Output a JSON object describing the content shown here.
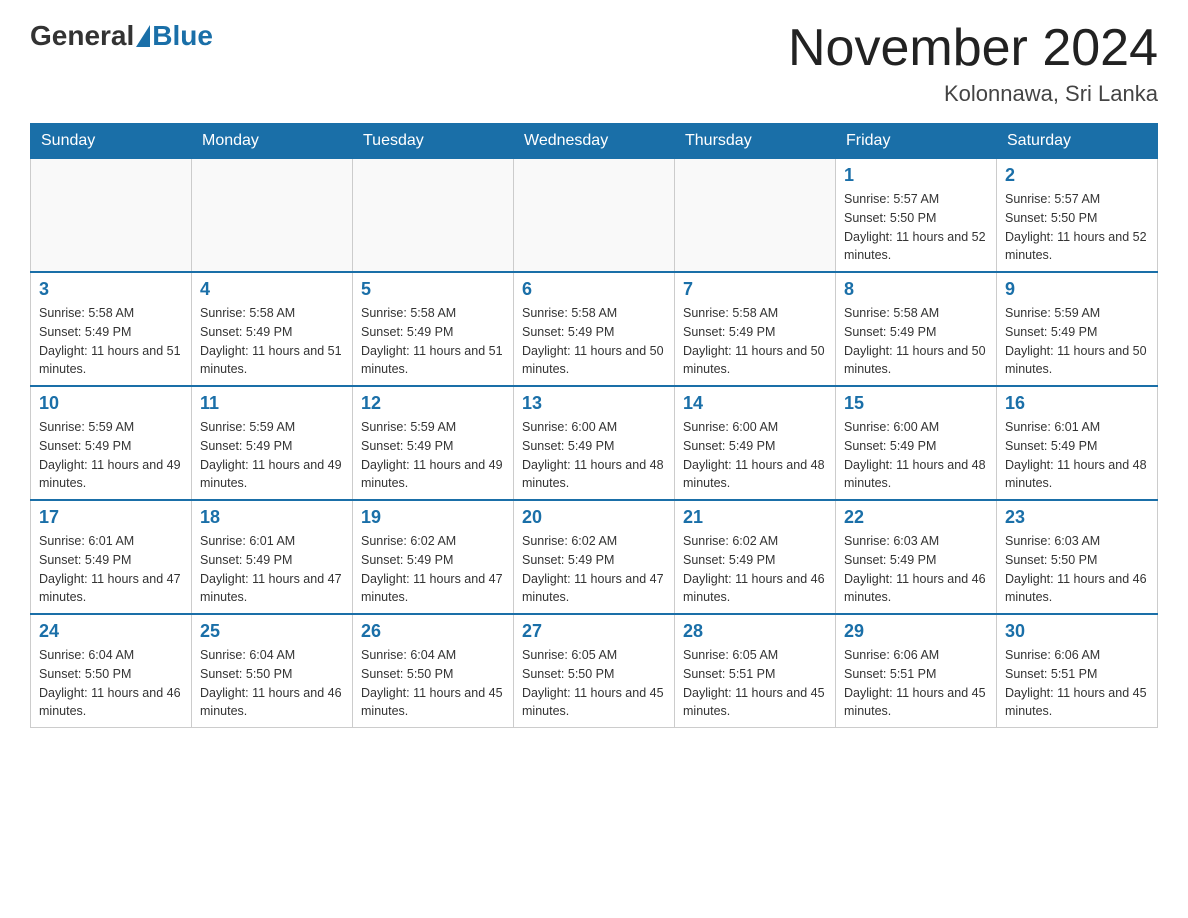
{
  "header": {
    "logo_general": "General",
    "logo_blue": "Blue",
    "month_year": "November 2024",
    "location": "Kolonnawa, Sri Lanka"
  },
  "weekdays": [
    "Sunday",
    "Monday",
    "Tuesday",
    "Wednesday",
    "Thursday",
    "Friday",
    "Saturday"
  ],
  "weeks": [
    [
      {
        "day": "",
        "sunrise": "",
        "sunset": "",
        "daylight": ""
      },
      {
        "day": "",
        "sunrise": "",
        "sunset": "",
        "daylight": ""
      },
      {
        "day": "",
        "sunrise": "",
        "sunset": "",
        "daylight": ""
      },
      {
        "day": "",
        "sunrise": "",
        "sunset": "",
        "daylight": ""
      },
      {
        "day": "",
        "sunrise": "",
        "sunset": "",
        "daylight": ""
      },
      {
        "day": "1",
        "sunrise": "Sunrise: 5:57 AM",
        "sunset": "Sunset: 5:50 PM",
        "daylight": "Daylight: 11 hours and 52 minutes."
      },
      {
        "day": "2",
        "sunrise": "Sunrise: 5:57 AM",
        "sunset": "Sunset: 5:50 PM",
        "daylight": "Daylight: 11 hours and 52 minutes."
      }
    ],
    [
      {
        "day": "3",
        "sunrise": "Sunrise: 5:58 AM",
        "sunset": "Sunset: 5:49 PM",
        "daylight": "Daylight: 11 hours and 51 minutes."
      },
      {
        "day": "4",
        "sunrise": "Sunrise: 5:58 AM",
        "sunset": "Sunset: 5:49 PM",
        "daylight": "Daylight: 11 hours and 51 minutes."
      },
      {
        "day": "5",
        "sunrise": "Sunrise: 5:58 AM",
        "sunset": "Sunset: 5:49 PM",
        "daylight": "Daylight: 11 hours and 51 minutes."
      },
      {
        "day": "6",
        "sunrise": "Sunrise: 5:58 AM",
        "sunset": "Sunset: 5:49 PM",
        "daylight": "Daylight: 11 hours and 50 minutes."
      },
      {
        "day": "7",
        "sunrise": "Sunrise: 5:58 AM",
        "sunset": "Sunset: 5:49 PM",
        "daylight": "Daylight: 11 hours and 50 minutes."
      },
      {
        "day": "8",
        "sunrise": "Sunrise: 5:58 AM",
        "sunset": "Sunset: 5:49 PM",
        "daylight": "Daylight: 11 hours and 50 minutes."
      },
      {
        "day": "9",
        "sunrise": "Sunrise: 5:59 AM",
        "sunset": "Sunset: 5:49 PM",
        "daylight": "Daylight: 11 hours and 50 minutes."
      }
    ],
    [
      {
        "day": "10",
        "sunrise": "Sunrise: 5:59 AM",
        "sunset": "Sunset: 5:49 PM",
        "daylight": "Daylight: 11 hours and 49 minutes."
      },
      {
        "day": "11",
        "sunrise": "Sunrise: 5:59 AM",
        "sunset": "Sunset: 5:49 PM",
        "daylight": "Daylight: 11 hours and 49 minutes."
      },
      {
        "day": "12",
        "sunrise": "Sunrise: 5:59 AM",
        "sunset": "Sunset: 5:49 PM",
        "daylight": "Daylight: 11 hours and 49 minutes."
      },
      {
        "day": "13",
        "sunrise": "Sunrise: 6:00 AM",
        "sunset": "Sunset: 5:49 PM",
        "daylight": "Daylight: 11 hours and 48 minutes."
      },
      {
        "day": "14",
        "sunrise": "Sunrise: 6:00 AM",
        "sunset": "Sunset: 5:49 PM",
        "daylight": "Daylight: 11 hours and 48 minutes."
      },
      {
        "day": "15",
        "sunrise": "Sunrise: 6:00 AM",
        "sunset": "Sunset: 5:49 PM",
        "daylight": "Daylight: 11 hours and 48 minutes."
      },
      {
        "day": "16",
        "sunrise": "Sunrise: 6:01 AM",
        "sunset": "Sunset: 5:49 PM",
        "daylight": "Daylight: 11 hours and 48 minutes."
      }
    ],
    [
      {
        "day": "17",
        "sunrise": "Sunrise: 6:01 AM",
        "sunset": "Sunset: 5:49 PM",
        "daylight": "Daylight: 11 hours and 47 minutes."
      },
      {
        "day": "18",
        "sunrise": "Sunrise: 6:01 AM",
        "sunset": "Sunset: 5:49 PM",
        "daylight": "Daylight: 11 hours and 47 minutes."
      },
      {
        "day": "19",
        "sunrise": "Sunrise: 6:02 AM",
        "sunset": "Sunset: 5:49 PM",
        "daylight": "Daylight: 11 hours and 47 minutes."
      },
      {
        "day": "20",
        "sunrise": "Sunrise: 6:02 AM",
        "sunset": "Sunset: 5:49 PM",
        "daylight": "Daylight: 11 hours and 47 minutes."
      },
      {
        "day": "21",
        "sunrise": "Sunrise: 6:02 AM",
        "sunset": "Sunset: 5:49 PM",
        "daylight": "Daylight: 11 hours and 46 minutes."
      },
      {
        "day": "22",
        "sunrise": "Sunrise: 6:03 AM",
        "sunset": "Sunset: 5:49 PM",
        "daylight": "Daylight: 11 hours and 46 minutes."
      },
      {
        "day": "23",
        "sunrise": "Sunrise: 6:03 AM",
        "sunset": "Sunset: 5:50 PM",
        "daylight": "Daylight: 11 hours and 46 minutes."
      }
    ],
    [
      {
        "day": "24",
        "sunrise": "Sunrise: 6:04 AM",
        "sunset": "Sunset: 5:50 PM",
        "daylight": "Daylight: 11 hours and 46 minutes."
      },
      {
        "day": "25",
        "sunrise": "Sunrise: 6:04 AM",
        "sunset": "Sunset: 5:50 PM",
        "daylight": "Daylight: 11 hours and 46 minutes."
      },
      {
        "day": "26",
        "sunrise": "Sunrise: 6:04 AM",
        "sunset": "Sunset: 5:50 PM",
        "daylight": "Daylight: 11 hours and 45 minutes."
      },
      {
        "day": "27",
        "sunrise": "Sunrise: 6:05 AM",
        "sunset": "Sunset: 5:50 PM",
        "daylight": "Daylight: 11 hours and 45 minutes."
      },
      {
        "day": "28",
        "sunrise": "Sunrise: 6:05 AM",
        "sunset": "Sunset: 5:51 PM",
        "daylight": "Daylight: 11 hours and 45 minutes."
      },
      {
        "day": "29",
        "sunrise": "Sunrise: 6:06 AM",
        "sunset": "Sunset: 5:51 PM",
        "daylight": "Daylight: 11 hours and 45 minutes."
      },
      {
        "day": "30",
        "sunrise": "Sunrise: 6:06 AM",
        "sunset": "Sunset: 5:51 PM",
        "daylight": "Daylight: 11 hours and 45 minutes."
      }
    ]
  ]
}
